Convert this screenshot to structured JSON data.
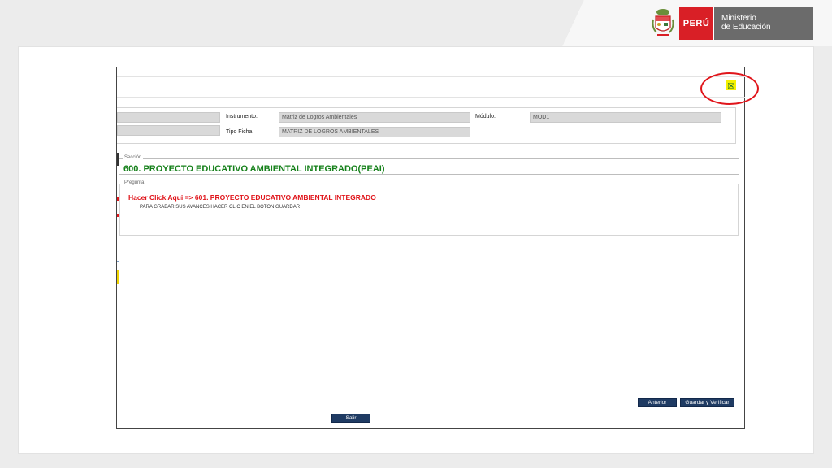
{
  "header": {
    "country": "PERÚ",
    "ministry_line1": "Ministerio",
    "ministry_line2": "de Educación"
  },
  "form": {
    "instrumento_label": "Instrumento:",
    "instrumento_value": "Matriz de Logros Ambientales",
    "modulo_label": "Módulo:",
    "modulo_value": "MOD1",
    "tipo_ficha_label": "Tipo Ficha:",
    "tipo_ficha_value": "MATRIZ DE LOGROS AMBIENTALES"
  },
  "section": {
    "legend": "Sección",
    "title": "600. PROYECTO EDUCATIVO AMBIENTAL INTEGRADO(PEAI)"
  },
  "question": {
    "legend": "Pregunta",
    "link_text": "Hacer Click Aqui => 601. PROYECTO EDUCATIVO AMBIENTAL INTEGRADO",
    "note": "PARA GRABAR SUS AVANCES HACER CLIC EN EL BOTON GUARDAR"
  },
  "buttons": {
    "anterior": "Anterior",
    "guardar": "Guardar y Verificar",
    "salir": "Salir"
  },
  "colors": {
    "brand_red": "#d91f26",
    "section_green": "#15801a",
    "button_navy": "#1f3b63",
    "highlight_yellow": "#f4f000"
  },
  "icons": {
    "excel": "excel-export-icon",
    "crest": "coat-of-arms-icon"
  }
}
